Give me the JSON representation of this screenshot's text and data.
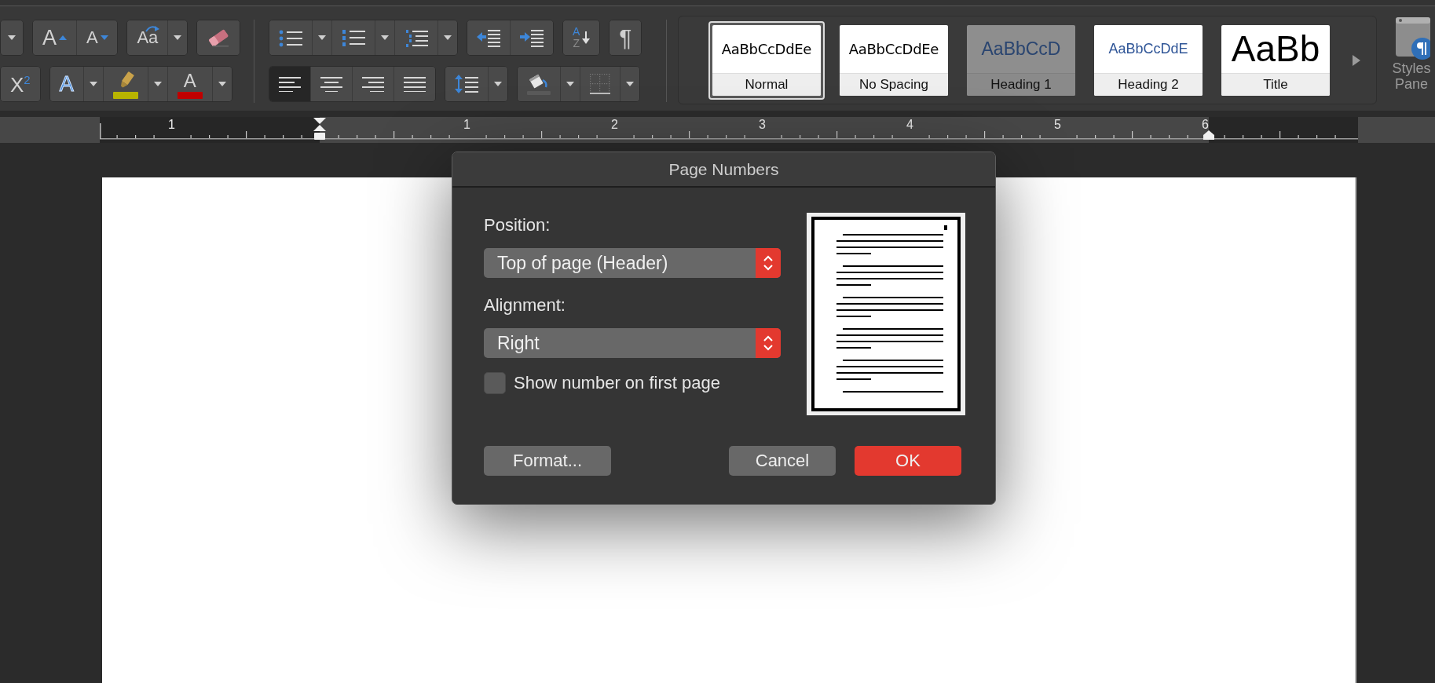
{
  "ribbon": {
    "row_1": {
      "font_groups": [
        {
          "items": [
            {
              "kind": "caret"
            }
          ]
        },
        {
          "items": [
            {
              "kind": "grow",
              "glyph": "A"
            },
            {
              "kind": "shrink",
              "glyph": "A"
            }
          ]
        },
        {
          "items": [
            {
              "kind": "case",
              "glyph": "Aa",
              "dropdown": true
            }
          ]
        },
        {
          "items": [
            {
              "kind": "eraser"
            }
          ]
        }
      ],
      "paragraph_groups": [
        {
          "items": [
            {
              "kind": "bullets",
              "dropdown": true
            },
            {
              "kind": "numbering",
              "dropdown": true
            },
            {
              "kind": "multilevel",
              "dropdown": true
            }
          ]
        },
        {
          "items": [
            {
              "kind": "outdent"
            },
            {
              "kind": "indent"
            }
          ]
        },
        {
          "items": [
            {
              "kind": "sort",
              "glyph": "A",
              "glyph_2": "Z"
            }
          ]
        },
        {
          "items": [
            {
              "kind": "pilcrow",
              "glyph": "¶"
            }
          ]
        }
      ]
    },
    "row_2": {
      "font_groups": [
        {
          "items": [
            {
              "kind": "superscript",
              "glyph": "X$^{2}$"
            }
          ]
        },
        {
          "items": [
            {
              "kind": "effects",
              "glyph": "A",
              "dropdown": true
            },
            {
              "kind": "highlight",
              "color": "#b8b400",
              "dropdown": true
            },
            {
              "kind": "fontcolor",
              "glyph": "A",
              "color": "#c00000",
              "dropdown": true
            }
          ]
        }
      ],
      "paragraph_groups": [
        {
          "items": [
            {
              "kind": "align-left",
              "selected": true
            },
            {
              "kind": "align-center",
              "selected": false
            },
            {
              "kind": "align-right",
              "selected": false
            },
            {
              "kind": "justify",
              "selected": false
            }
          ]
        },
        {
          "items": [
            {
              "kind": "spacing",
              "dropdown": true
            }
          ]
        },
        {
          "items": [
            {
              "kind": "shading",
              "dropdown": true
            },
            {
              "kind": "borders",
              "dropdown": true
            }
          ]
        }
      ]
    }
  },
  "styles_gallery": [
    {
      "kind": "normal",
      "sample": "AaBbCcDdEe",
      "name": "Normal",
      "selected": true,
      "highlighted": false
    },
    {
      "kind": "plain",
      "sample": "AaBbCcDdEe",
      "name": "No Spacing",
      "selected": false,
      "highlighted": false
    },
    {
      "kind": "heading1",
      "sample": "AaBbCcD",
      "name": "Heading 1",
      "selected": false,
      "highlighted": true
    },
    {
      "kind": "heading2",
      "sample": "AaBbCcDdE",
      "name": "Heading 2",
      "selected": false,
      "highlighted": false
    },
    {
      "kind": "title",
      "sample": "AaBb",
      "name": "Title",
      "selected": false,
      "highlighted": false
    }
  ],
  "styles_pane": {
    "label": "Styles Pane"
  },
  "ruler": {
    "labels": [
      "1",
      "1",
      "2",
      "3",
      "4",
      "5",
      "6"
    ]
  },
  "dialog": {
    "title": "Page Numbers",
    "position": {
      "label": "Position:",
      "value": "Top of page (Header)"
    },
    "alignment": {
      "label": "Alignment:",
      "value": "Right"
    },
    "first_page": {
      "label": "Show number on first page",
      "checked": false
    },
    "buttons": [
      {
        "label": "Format...",
        "kind": "secondary"
      },
      {
        "label": "Cancel",
        "kind": "secondary"
      },
      {
        "label": "OK",
        "kind": "primary"
      }
    ]
  }
}
